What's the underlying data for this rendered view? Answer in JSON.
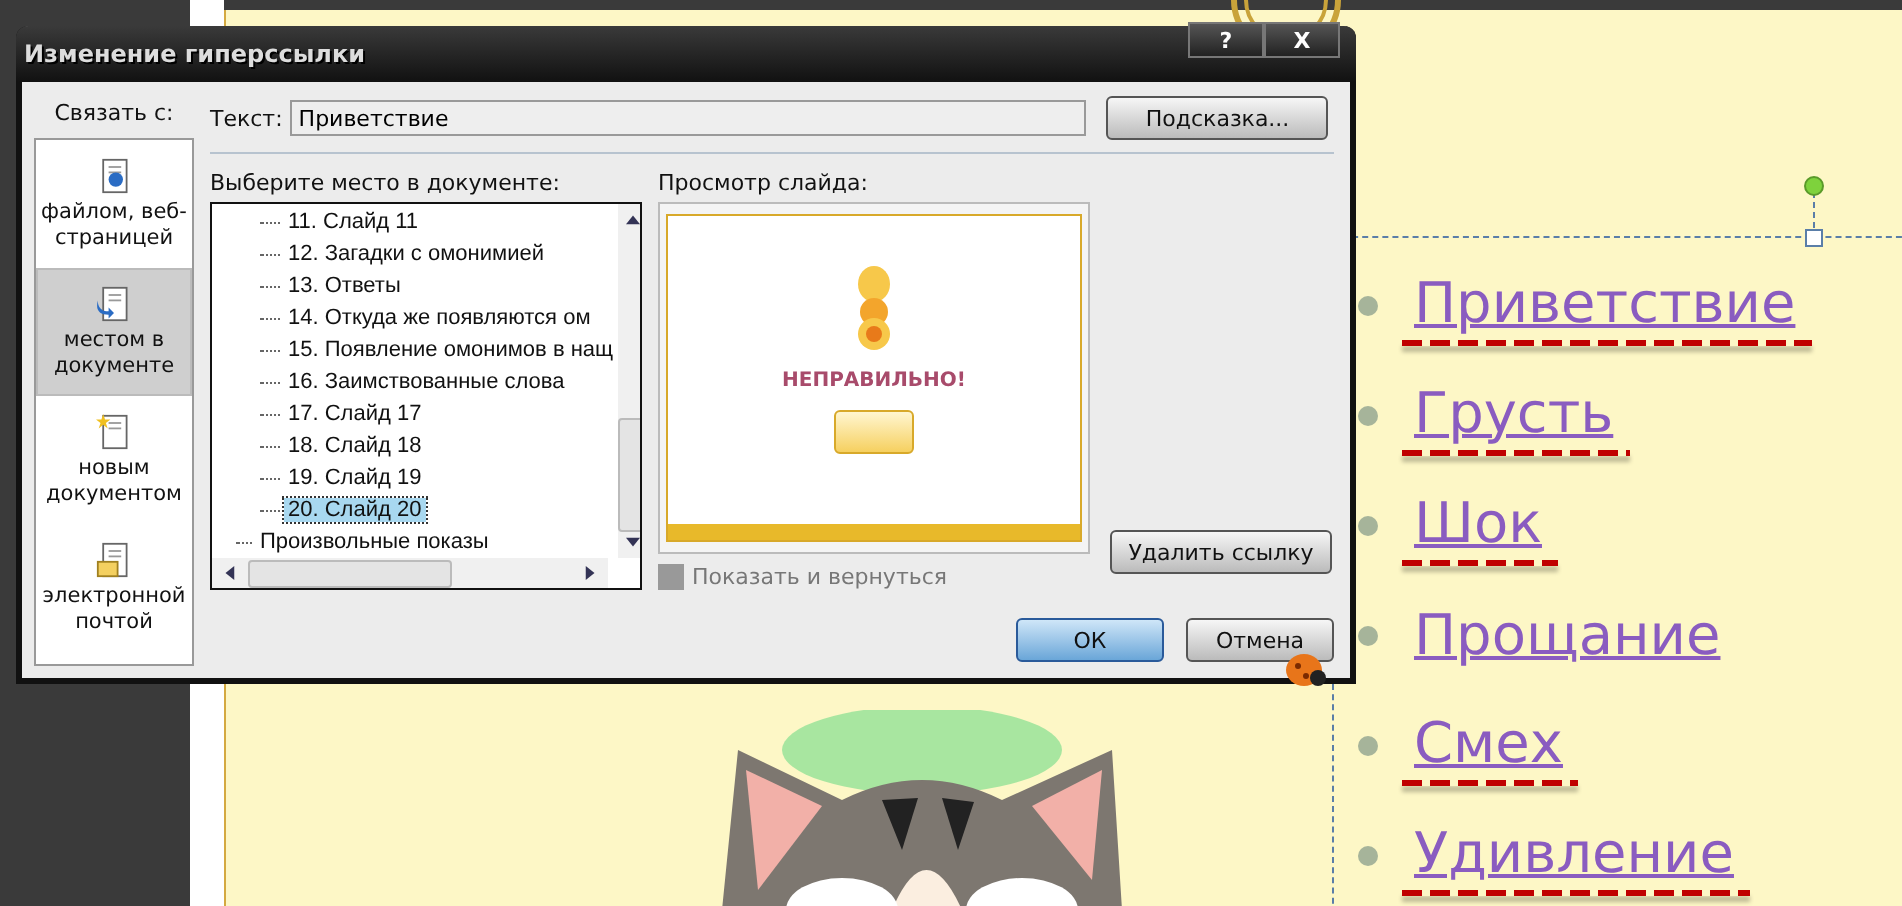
{
  "dialog": {
    "title": "Изменение гиперссылки",
    "help_button": "?",
    "close_button": "X",
    "link_to_label": "Связать с:",
    "link_targets": [
      {
        "label": "файлом, веб-страницей",
        "kind": "file",
        "selected": false
      },
      {
        "label": "местом в документе",
        "kind": "place",
        "selected": true
      },
      {
        "label": "новым документом",
        "kind": "new",
        "selected": false
      },
      {
        "label": "электронной почтой",
        "kind": "mail",
        "selected": false
      }
    ],
    "text_label": "Текст:",
    "text_value": "Приветствие",
    "tip_button": "Подсказка...",
    "place_label": "Выберите место в документе:",
    "slides": [
      {
        "label": "11. Слайд 11",
        "selected": false
      },
      {
        "label": "12. Загадки с омонимией",
        "selected": false
      },
      {
        "label": "13. Ответы",
        "selected": false
      },
      {
        "label": "14. Откуда же  появляются ом",
        "selected": false
      },
      {
        "label": "15. Появление омонимов в нащ",
        "selected": false
      },
      {
        "label": "16. Заимствованные слова",
        "selected": false
      },
      {
        "label": "17. Слайд 17",
        "selected": false
      },
      {
        "label": "18. Слайд 18",
        "selected": false
      },
      {
        "label": "19. Слайд 19",
        "selected": false
      },
      {
        "label": "20. Слайд 20",
        "selected": true
      }
    ],
    "custom_shows": "Произвольные показы",
    "preview_label": "Просмотр слайда:",
    "preview_heading": "НЕПРАВИЛЬНО!",
    "show_and_return": {
      "label": "Показать и вернуться",
      "checked": false,
      "disabled": true
    },
    "remove_button": "Удалить ссылку",
    "ok_button": "ОК",
    "cancel_button": "Отмена"
  },
  "slide": {
    "items": [
      {
        "text": "Приветствие",
        "marked": true
      },
      {
        "text": "Грусть",
        "marked": true
      },
      {
        "text": "Шок",
        "marked": true
      },
      {
        "text": "Прощание",
        "marked": false
      },
      {
        "text": "Смех",
        "marked": true
      },
      {
        "text": "Удивление",
        "marked": true
      }
    ]
  }
}
